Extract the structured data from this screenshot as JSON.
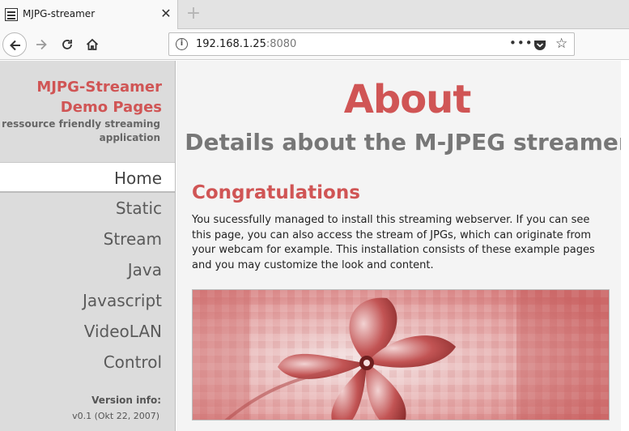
{
  "browser": {
    "tab_title": "MJPG-streamer",
    "url_host": "192.168.1.25",
    "url_port": ":8080",
    "icons": [
      "page-favicon-icon",
      "close-icon",
      "plus-icon",
      "back-arrow-icon",
      "forward-arrow-icon",
      "reload-icon",
      "home-icon",
      "info-icon",
      "more-dots-icon",
      "pocket-icon",
      "star-icon"
    ]
  },
  "sidebar": {
    "brand_line1": "MJPG-Streamer",
    "brand_line2": "Demo Pages",
    "tagline": "a ressource friendly streaming application",
    "menu": [
      {
        "label": "Home",
        "active": true
      },
      {
        "label": "Static",
        "active": false
      },
      {
        "label": "Stream",
        "active": false
      },
      {
        "label": "Java",
        "active": false
      },
      {
        "label": "Javascript",
        "active": false
      },
      {
        "label": "VideoLAN",
        "active": false
      },
      {
        "label": "Control",
        "active": false
      }
    ],
    "version_title": "Version info:",
    "version_value": "v0.1 (Okt 22, 2007)"
  },
  "main": {
    "title": "About",
    "subtitle": "Details about the M-JPEG streamer",
    "section_heading": "Congratulations",
    "paragraph": "You sucessfully managed to install this streaming webserver. If you can see this page, you can also access the stream of JPGs, which can originate from your webcam for example. This installation consists of these example pages and you may customize the look and content."
  },
  "colors": {
    "accent": "#d05555",
    "sidebar_bg": "#dcdcdc",
    "content_bg": "#f4f4f4"
  }
}
